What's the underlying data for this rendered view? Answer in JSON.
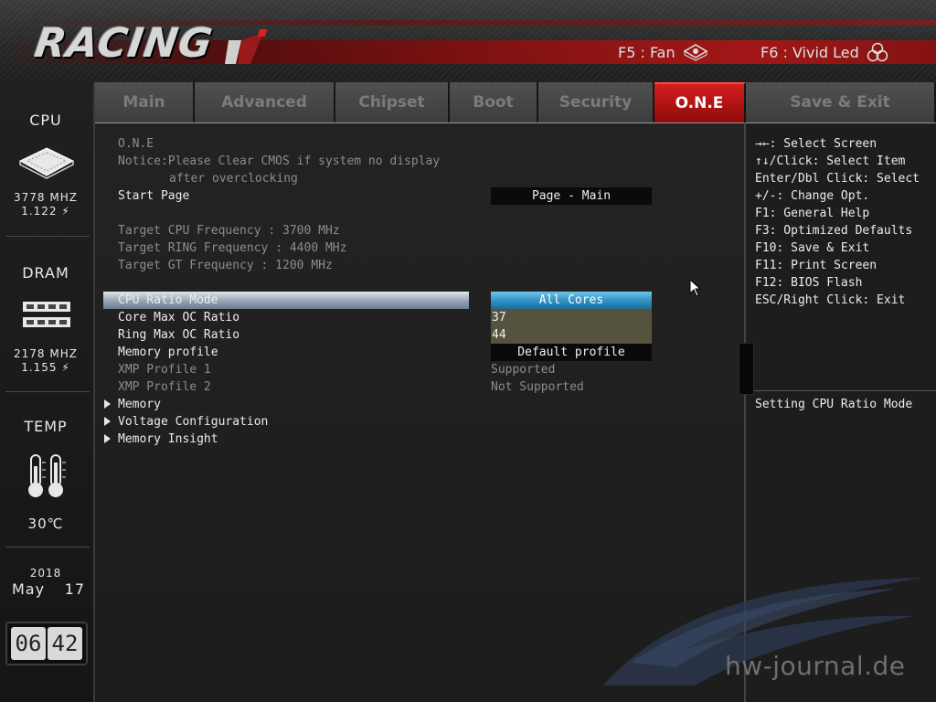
{
  "header": {
    "logo_text": "RACING",
    "hotkeys": [
      {
        "label": "F5 : Fan",
        "icon": "fan-icon"
      },
      {
        "label": "F6 : Vivid Led",
        "icon": "led-icon"
      }
    ]
  },
  "sidebar": {
    "cpu": {
      "label": "CPU",
      "freq": "3778 MHZ",
      "volt": "1.122 ⚡"
    },
    "dram": {
      "label": "DRAM",
      "freq": "2178 MHZ",
      "volt": "1.155 ⚡"
    },
    "temp": {
      "label": "TEMP",
      "value": "30℃"
    },
    "date": {
      "year": "2018",
      "month": "May",
      "day": "17"
    },
    "clock": {
      "hour": "06",
      "minute": "42"
    }
  },
  "tabs": [
    {
      "label": "Main",
      "active": false
    },
    {
      "label": "Advanced",
      "active": false
    },
    {
      "label": "Chipset",
      "active": false
    },
    {
      "label": "Boot",
      "active": false
    },
    {
      "label": "Security",
      "active": false
    },
    {
      "label": "O.N.E",
      "active": true
    },
    {
      "label": "Save & Exit",
      "active": false
    }
  ],
  "content": {
    "section_title": "O.N.E",
    "notice_1": "Notice:Please Clear CMOS if system no display",
    "notice_2": "after overclocking",
    "start_page": {
      "label": "Start Page",
      "value": "Page - Main"
    },
    "targets": [
      "Target CPU Frequency : 3700 MHz",
      "Target RING Frequency : 4400 MHz",
      "Target GT Frequency : 1200 MHz"
    ],
    "settings": [
      {
        "label": "CPU Ratio Mode",
        "value": "All Cores"
      },
      {
        "label": "Core Max OC Ratio",
        "value": "37"
      },
      {
        "label": "Ring Max OC Ratio",
        "value": "44"
      },
      {
        "label": "Memory profile",
        "value": "Default profile"
      },
      {
        "label": "XMP Profile 1",
        "value": "Supported"
      },
      {
        "label": "XMP Profile 2",
        "value": "Not Supported"
      }
    ],
    "submenus": [
      "Memory",
      "Voltage Configuration",
      "Memory Insight"
    ]
  },
  "help": {
    "keys": [
      "→←: Select Screen",
      "↑↓/Click: Select Item",
      "Enter/Dbl Click: Select",
      "+/-: Change Opt.",
      "F1: General Help",
      "F3: Optimized Defaults",
      "F10: Save & Exit",
      "F11: Print Screen",
      "F12: BIOS Flash",
      "ESC/Right Click: Exit"
    ],
    "description": "Setting CPU Ratio Mode"
  },
  "watermark": "hw-journal.de",
  "colors": {
    "accent_red": "#c21616",
    "selection_blue": "#3a9bd0",
    "value_olive": "#55533d"
  }
}
